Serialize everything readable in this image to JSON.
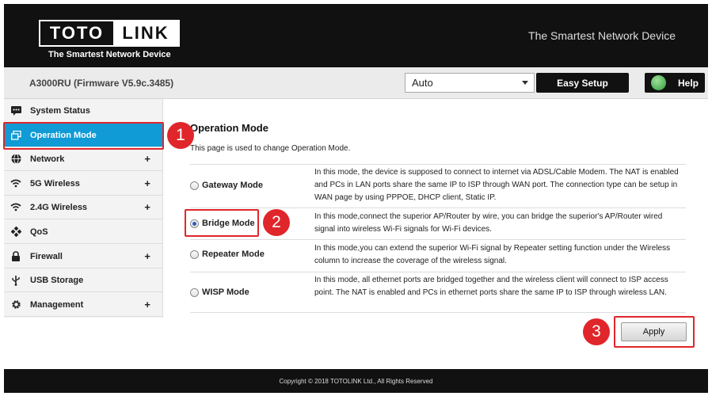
{
  "header": {
    "logo_left": "TOTO",
    "logo_right": "LINK",
    "logo_tagline": "The Smartest Network Device",
    "slogan": "The Smartest Network Device"
  },
  "subbar": {
    "model": "A3000RU (Firmware V5.9c.3485)",
    "language_value": "Auto",
    "easy_setup_label": "Easy Setup",
    "help_label": "Help"
  },
  "sidebar": {
    "items": [
      {
        "label": "System Status",
        "icon": "chat-bubble-icon",
        "expand": ""
      },
      {
        "label": "Operation Mode",
        "icon": "windows-icon",
        "expand": ""
      },
      {
        "label": "Network",
        "icon": "globe-icon",
        "expand": "+"
      },
      {
        "label": "5G Wireless",
        "icon": "wifi-icon",
        "expand": "+"
      },
      {
        "label": "2.4G Wireless",
        "icon": "wifi-icon",
        "expand": "+"
      },
      {
        "label": "QoS",
        "icon": "diamond-icon",
        "expand": ""
      },
      {
        "label": "Firewall",
        "icon": "lock-icon",
        "expand": "+"
      },
      {
        "label": "USB Storage",
        "icon": "usb-icon",
        "expand": ""
      },
      {
        "label": "Management",
        "icon": "gear-icon",
        "expand": "+"
      }
    ],
    "active_index": 1
  },
  "main": {
    "title": "Operation Mode",
    "description": "This page is used to change Operation Mode.",
    "modes": [
      {
        "label": "Gateway Mode",
        "text": "In this mode, the device is supposed to connect to internet via ADSL/Cable Modem. The NAT is enabled and PCs in LAN ports share the same IP to ISP through WAN port. The connection type can be setup in WAN page by using PPPOE, DHCP client, Static IP."
      },
      {
        "label": "Bridge Mode",
        "text": "In this mode,connect the superior AP/Router by wire, you can bridge the superior's AP/Router wired signal into wireless Wi-Fi signals for Wi-Fi devices."
      },
      {
        "label": "Repeater Mode",
        "text": "In this mode,you can extend the superior Wi-Fi signal by Repeater setting function under the Wireless column to increase the coverage of the wireless signal."
      },
      {
        "label": "WISP Mode",
        "text": "In this mode, all ethernet ports are bridged together and the wireless client will connect to ISP access point. The NAT is enabled and PCs in ethernet ports share the same IP to ISP through wireless LAN."
      }
    ],
    "selected_mode": "Bridge Mode",
    "apply_label": "Apply"
  },
  "annotations": {
    "step1": "1",
    "step2": "2",
    "step3": "3",
    "color": "#e0262b"
  },
  "footer": {
    "copyright": "Copyright © 2018 TOTOLINK Ltd.,   All Rights Reserved"
  },
  "colors": {
    "header_bg": "#111111",
    "active_nav": "#109bd6"
  }
}
